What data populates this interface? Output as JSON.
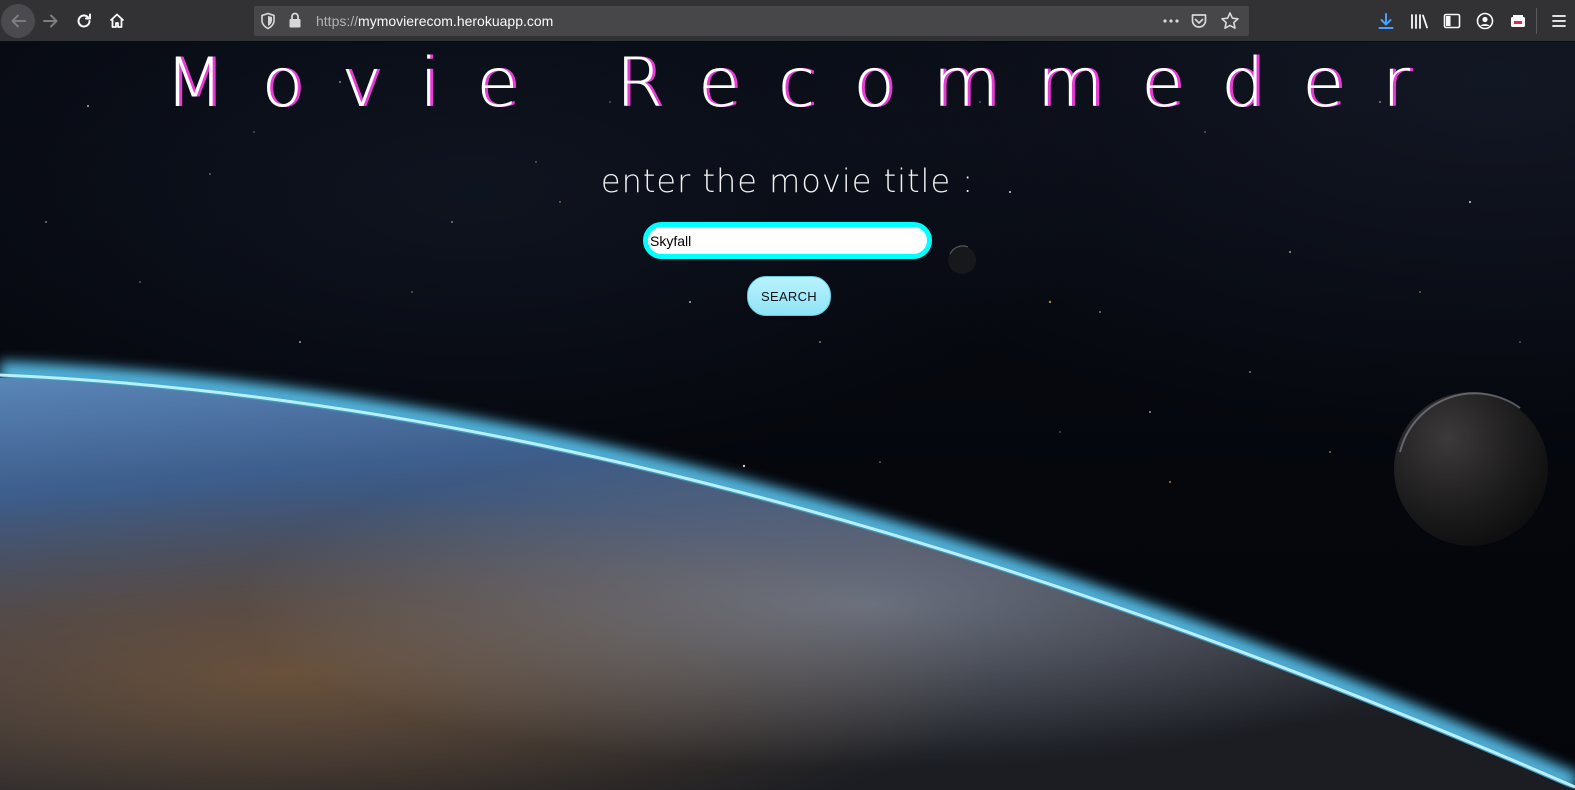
{
  "browser": {
    "url_protocol": "https://",
    "url_host": "mymovierecom.herokuapp.com",
    "icons": {
      "back": "back-arrow-icon",
      "forward": "forward-arrow-icon",
      "reload": "reload-icon",
      "home": "home-icon",
      "shield": "tracking-shield-icon",
      "lock": "lock-icon",
      "more": "more-dots-icon",
      "pocket": "pocket-icon",
      "bookmark": "star-icon",
      "download": "download-icon",
      "library": "library-icon",
      "sidebar": "sidebar-icon",
      "account": "account-icon",
      "screenshot": "screenshot-icon",
      "menu": "hamburger-menu-icon"
    },
    "accent_color": "#0a84ff"
  },
  "page": {
    "title": "Movie Recommeder",
    "subtitle": "enter the movie title :",
    "search_value": "Skyfall",
    "search_button_label": "SEARCH",
    "colors": {
      "title_shadow": "#e83bd6",
      "input_border": "#00ffff",
      "button_bg": "#a6ecfb"
    }
  }
}
